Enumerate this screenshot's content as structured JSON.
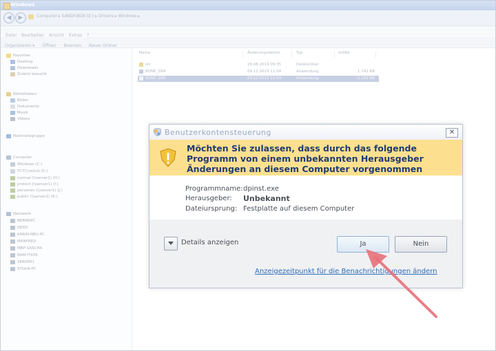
{
  "window": {
    "title": "Windows"
  },
  "address": {
    "breadcrumb": "Computer ▸ SANDY-BOX (E:) ▸ Drivers ▸ Windows ▸"
  },
  "menu": [
    "Datei",
    "Bearbeiten",
    "Ansicht",
    "Extras",
    "?"
  ],
  "toolbar": [
    "Organisieren ▾",
    "Öffnen",
    "Brennen",
    "Neuer Ordner"
  ],
  "sidebar": {
    "favorites": {
      "label": "Favoriten",
      "items": [
        "Desktop",
        "Downloads",
        "Zuletzt besucht"
      ]
    },
    "libraries": {
      "label": "Bibliotheken",
      "items": [
        "Bilder",
        "Dokumente",
        "Musik",
        "Videos"
      ]
    },
    "homegroup": "Heimnetzgruppe",
    "computer": {
      "label": "Computer",
      "items": [
        "Windows (C:)",
        "TCTControl (E:)",
        "normal (\\\\server1) (H:)",
        "protect (\\\\server1) (I:)",
        "personen (\\\\server1) (J:)",
        "public (\\\\server1) (K:)"
      ]
    },
    "network": {
      "label": "Netzwerk",
      "items": [
        "BERNDPC",
        "HEIDI",
        "KARIN-NBU-PC",
        "MANFRED",
        "MBP-SASCHA",
        "RAM-IT43S",
        "SERVER1",
        "SYLVIA-PC"
      ]
    }
  },
  "files": {
    "columns": [
      "Name",
      "Änderungsdatum",
      "Typ",
      "Größe"
    ],
    "rows": [
      {
        "name": "src",
        "date": "26.08.2014 09:35",
        "type": "Dateiordner",
        "size": ""
      },
      {
        "name": "BONE_D64",
        "date": "09.12.2013 11:54",
        "type": "Anwendung",
        "size": "1.142 KB"
      },
      {
        "name": "BONE_D86",
        "date": "09.12.2013 11:54",
        "type": "Anwendung",
        "size": "1.143 KB"
      }
    ]
  },
  "uac": {
    "title": "Benutzerkontensteuerung",
    "close_label": "✕",
    "question": "Möchten Sie zulassen, dass durch das folgende Programm von einem unbekannten Herausgeber Änderungen an diesem Computer vorgenommen werden?",
    "program_label": "Programmname:",
    "program_value": "dpinst.exe",
    "publisher_label": "Herausgeber:",
    "publisher_value": "Unbekannt",
    "origin_label": "Dateiursprung:",
    "origin_value": "Festplatte auf diesem Computer",
    "details_label": "Details anzeigen",
    "yes_label": "Ja",
    "no_label": "Nein",
    "link_label": "Anzeigezeitpunkt für die Benachrichtigungen ändern"
  },
  "colors": {
    "banner": "#fde08f",
    "arrow": "#e8707a",
    "link": "#2e6cb8",
    "title": "#1f3b74"
  }
}
